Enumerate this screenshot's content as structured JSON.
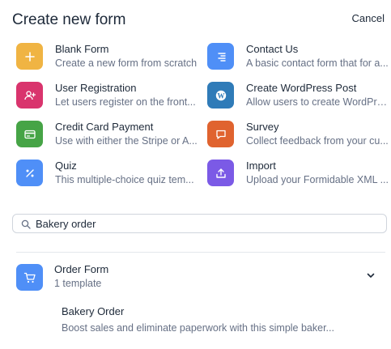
{
  "header": {
    "title": "Create new form",
    "cancel_label": "Cancel"
  },
  "templates": [
    {
      "name": "Blank Form",
      "desc": "Create a new form from scratch",
      "color": "#f0b443",
      "icon": "plus-icon"
    },
    {
      "name": "Contact Us",
      "desc": "A basic contact form that for a...",
      "color": "#4f8ff7",
      "icon": "align-right-icon"
    },
    {
      "name": "User Registration",
      "desc": "Let users register on the front...",
      "color": "#d9346d",
      "icon": "user-add-icon"
    },
    {
      "name": "Create WordPress Post",
      "desc": "Allow users to create WordPres...",
      "color": "#2f7bb8",
      "icon": "wordpress-icon"
    },
    {
      "name": "Credit Card Payment",
      "desc": "Use with either the Stripe or A...",
      "color": "#46a446",
      "icon": "credit-card-icon"
    },
    {
      "name": "Survey",
      "desc": "Collect feedback from your cu...",
      "color": "#e0632f",
      "icon": "chat-bubble-icon"
    },
    {
      "name": "Quiz",
      "desc": "This multiple-choice quiz tem...",
      "color": "#4f8ff7",
      "icon": "percent-icon"
    },
    {
      "name": "Import",
      "desc": "Upload your Formidable XML ...",
      "color": "#7b5ae6",
      "icon": "upload-icon"
    }
  ],
  "search": {
    "value": "Bakery order",
    "icon": "search-icon"
  },
  "category": {
    "name": "Order Form",
    "count": "1 template",
    "color": "#4f8ff7",
    "icon": "cart-icon"
  },
  "result": {
    "name": "Bakery Order",
    "desc": "Boost sales and eliminate paperwork with this simple baker..."
  }
}
